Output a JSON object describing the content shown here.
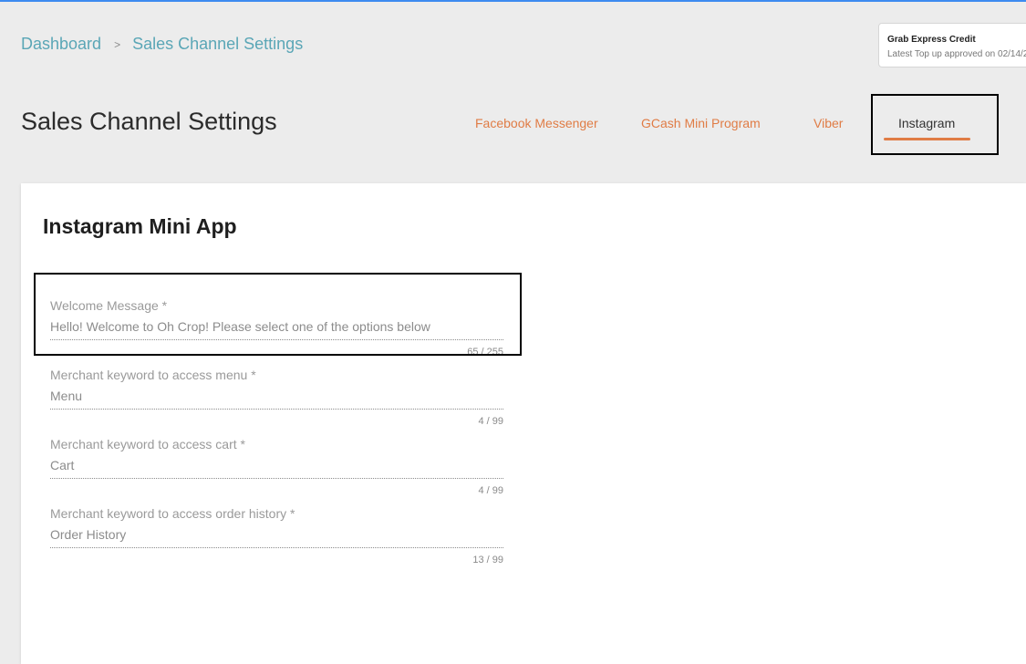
{
  "breadcrumb": {
    "root": "Dashboard",
    "separator": ">",
    "current": "Sales Channel Settings"
  },
  "toast": {
    "title": "Grab Express Credit",
    "message": "Latest Top up approved on 02/14/2"
  },
  "page": {
    "title": "Sales Channel Settings"
  },
  "tabs": [
    {
      "label": "Facebook Messenger",
      "active": false
    },
    {
      "label": "GCash Mini Program",
      "active": false
    },
    {
      "label": "Viber",
      "active": false
    },
    {
      "label": "Instagram",
      "active": true
    }
  ],
  "colors": {
    "accent": "#e07c45",
    "link": "#5aa6b6",
    "top_bar": "#3d8bf0"
  },
  "card": {
    "title": "Instagram Mini App",
    "fields": [
      {
        "label": "Welcome Message *",
        "value": "Hello! Welcome to Oh Crop! Please select one of the options below",
        "counter": "65 / 255"
      },
      {
        "label": "Merchant keyword to access menu *",
        "value": "Menu",
        "counter": "4 / 99"
      },
      {
        "label": "Merchant keyword to access cart *",
        "value": "Cart",
        "counter": "4 / 99"
      },
      {
        "label": "Merchant keyword to access order history *",
        "value": "Order History",
        "counter": "13 / 99"
      }
    ]
  }
}
